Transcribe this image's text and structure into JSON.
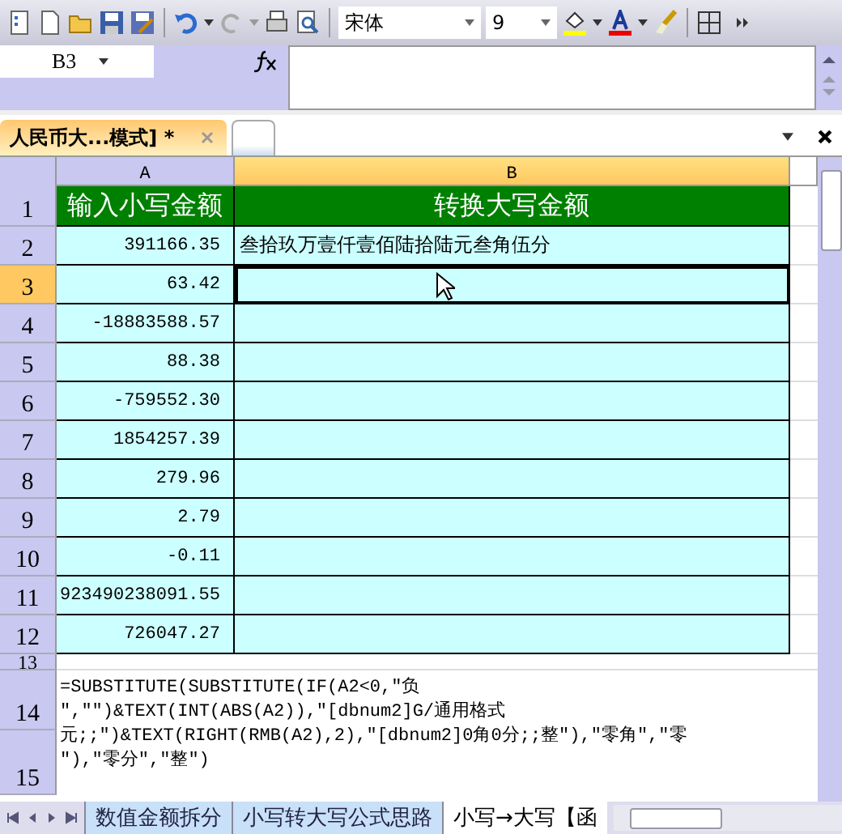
{
  "toolbar": {
    "font": "宋体",
    "size": "9"
  },
  "formula_bar": {
    "cell": "B3"
  },
  "doc_tab": {
    "label": "人民币大...模式] *"
  },
  "columns": [
    {
      "label": "A",
      "selected": false
    },
    {
      "label": "B",
      "selected": true
    }
  ],
  "rows": [
    {
      "num": "1",
      "kind": "header",
      "a": "输入小写金额",
      "b": "转换大写金额",
      "selected": false
    },
    {
      "num": "2",
      "kind": "data",
      "a": "391166.35",
      "b": "叁拾玖万壹仟壹佰陆拾陆元叁角伍分",
      "selected": false
    },
    {
      "num": "3",
      "kind": "data",
      "a": "63.42",
      "selected": true
    },
    {
      "num": "4",
      "kind": "data",
      "a": "-18883588.57",
      "selected": false
    },
    {
      "num": "5",
      "kind": "data",
      "a": "88.38",
      "selected": false
    },
    {
      "num": "6",
      "kind": "data",
      "a": "-759552.30",
      "selected": false
    },
    {
      "num": "7",
      "kind": "data",
      "a": "1854257.39",
      "selected": false
    },
    {
      "num": "8",
      "kind": "data",
      "a": "279.96",
      "selected": false
    },
    {
      "num": "9",
      "kind": "data",
      "a": "2.79",
      "selected": false
    },
    {
      "num": "10",
      "kind": "data",
      "a": "-0.11",
      "selected": false
    },
    {
      "num": "11",
      "kind": "data",
      "a": "923490238091.55",
      "selected": false
    },
    {
      "num": "12",
      "kind": "data",
      "a": "726047.27",
      "selected": false
    }
  ],
  "formula_block": {
    "row_numbers": [
      "13",
      "14",
      "15"
    ],
    "lines": [
      "=SUBSTITUTE(SUBSTITUTE(IF(A2<0,\"负",
      "\",\"\")&TEXT(INT(ABS(A2)),\"[dbnum2]G/通用格式",
      "元;;\")&TEXT(RIGHT(RMB(A2),2),\"[dbnum2]0角0分;;整\"),\"零角\",\"零",
      "\"),\"零分\",\"整\")"
    ]
  },
  "sheet_tabs": [
    {
      "label": "数值金额拆分",
      "selected": false
    },
    {
      "label": "小写转大写公式思路",
      "selected": false
    },
    {
      "label": "小写→大写【函",
      "selected": true
    }
  ]
}
